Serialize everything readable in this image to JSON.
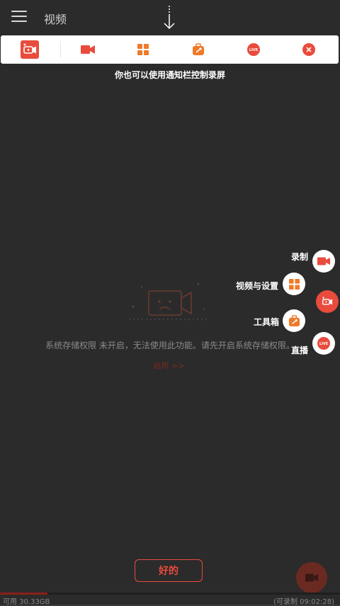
{
  "appbar": {
    "title": "视频",
    "menu_icon": "hamburger-menu-icon"
  },
  "notification_toolbar": {
    "items": [
      {
        "icon": "screen-record-app-icon"
      },
      {
        "icon": "video-camera-icon"
      },
      {
        "icon": "grid-icon"
      },
      {
        "icon": "toolbox-icon"
      },
      {
        "icon": "live-icon",
        "text": "LIVE"
      },
      {
        "icon": "close-icon"
      }
    ],
    "hint": "你也可以使用通知栏控制录屏"
  },
  "empty_state": {
    "message": "系统存储权限 未开启，无法使用此功能。请先开启系统存储权限。",
    "enable_link": "启用 >>"
  },
  "fab_menu": {
    "items": [
      {
        "label": "录制",
        "icon": "video-camera-icon"
      },
      {
        "label": "视频与设置",
        "icon": "grid-icon"
      },
      {
        "label": "工具箱",
        "icon": "toolbox-icon"
      },
      {
        "label": "直播",
        "icon": "live-icon",
        "text": "LIVE"
      }
    ],
    "main_icon": "screen-record-app-icon"
  },
  "ok_button": {
    "label": "好的"
  },
  "storage": {
    "available": "可用 30.33GB",
    "recordable": "(可录制 09:02:28)",
    "used_fraction": 0.14
  },
  "colors": {
    "accent": "#e94b3c",
    "orange": "#f07a2a",
    "overlay": "#2b2b2b"
  }
}
